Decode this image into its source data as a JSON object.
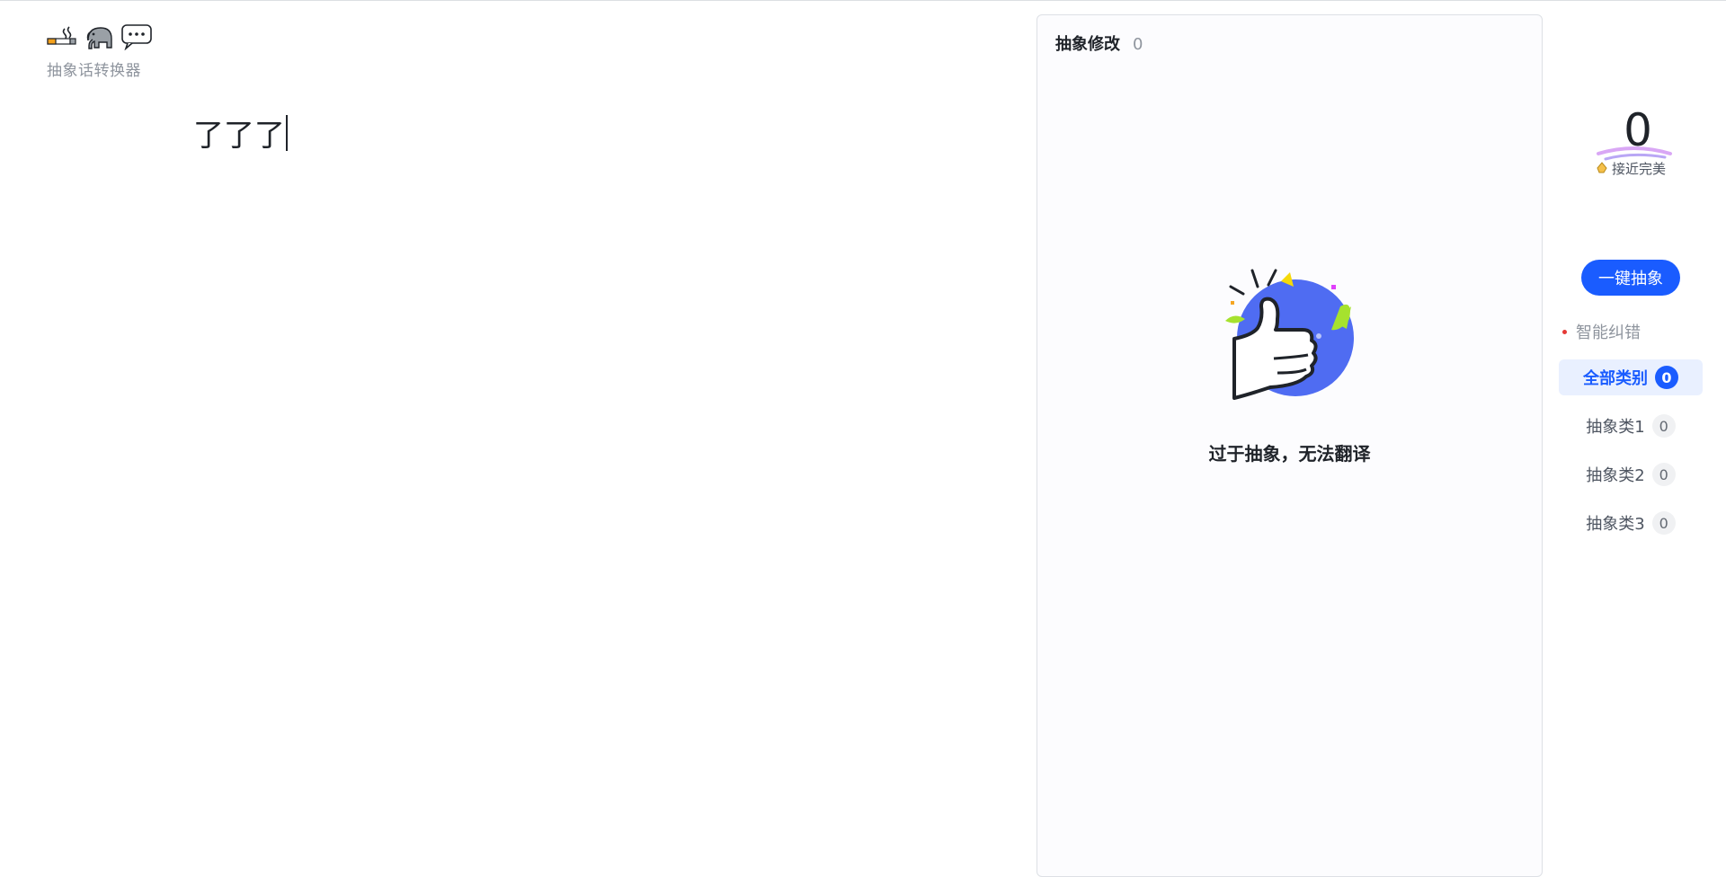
{
  "app": {
    "logo_emojis": [
      "smoking-icon",
      "elephant-icon",
      "speech-balloon-icon"
    ],
    "logo_text": "抽象话转换器"
  },
  "editor": {
    "text": "了了了"
  },
  "results": {
    "title": "抽象修改",
    "count": "0",
    "empty_message": "过于抽象，无法翻译"
  },
  "score": {
    "value": "0",
    "label": "接近完美"
  },
  "actions": {
    "one_click_label": "一键抽象",
    "smart_fix_label": "智能纠错"
  },
  "categories": [
    {
      "label": "全部类别",
      "count": "0",
      "active": true
    },
    {
      "label": "抽象类1",
      "count": "0",
      "active": false
    },
    {
      "label": "抽象类2",
      "count": "0",
      "active": false
    },
    {
      "label": "抽象类3",
      "count": "0",
      "active": false
    }
  ],
  "colors": {
    "accent": "#1a5cff",
    "illustration_blue": "#4f6cf2",
    "illustration_green": "#a6e22e",
    "illustration_yellow": "#f5d90a",
    "dot_red": "#e53935"
  }
}
